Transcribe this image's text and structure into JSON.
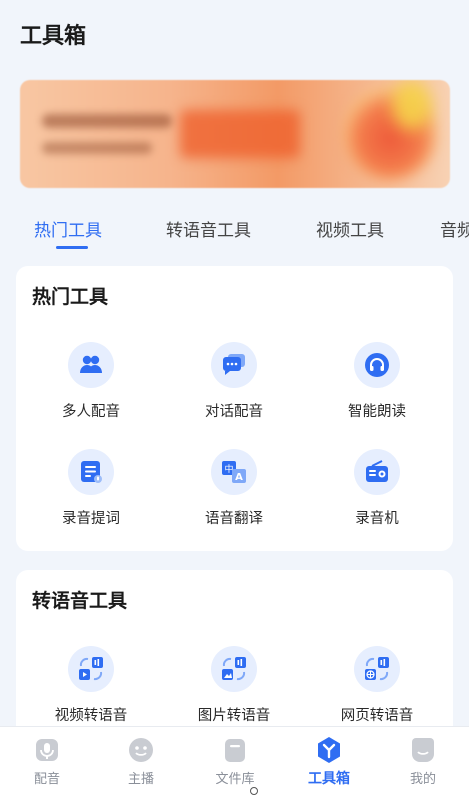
{
  "page": {
    "title": "工具箱"
  },
  "colors": {
    "accent": "#2f6df2",
    "icon_bg": "#e6eefe",
    "nav_inactive": "#c9ccd2"
  },
  "tabs": [
    {
      "label": "热门工具",
      "active": true
    },
    {
      "label": "转语音工具",
      "active": false
    },
    {
      "label": "视频工具",
      "active": false
    },
    {
      "label": "音频",
      "active": false
    }
  ],
  "hot_tools": {
    "title": "热门工具",
    "items": [
      {
        "label": "多人配音",
        "icon": "people-icon"
      },
      {
        "label": "对话配音",
        "icon": "chat-bubble-icon"
      },
      {
        "label": "智能朗读",
        "icon": "headphones-icon"
      },
      {
        "label": "录音提词",
        "icon": "teleprompter-icon"
      },
      {
        "label": "语音翻译",
        "icon": "translate-icon"
      },
      {
        "label": "录音机",
        "icon": "radio-recorder-icon"
      }
    ]
  },
  "tts_tools": {
    "title": "转语音工具",
    "items": [
      {
        "label": "视频转语音",
        "icon": "video-to-audio-icon"
      },
      {
        "label": "图片转语音",
        "icon": "image-to-audio-icon"
      },
      {
        "label": "网页转语音",
        "icon": "web-to-audio-icon"
      }
    ]
  },
  "bottom_nav": [
    {
      "label": "配音",
      "icon": "dubbing-icon",
      "active": false
    },
    {
      "label": "主播",
      "icon": "anchor-face-icon",
      "active": false
    },
    {
      "label": "文件库",
      "icon": "file-library-icon",
      "active": false
    },
    {
      "label": "工具箱",
      "icon": "toolbox-icon",
      "active": true
    },
    {
      "label": "我的",
      "icon": "profile-icon",
      "active": false
    }
  ]
}
